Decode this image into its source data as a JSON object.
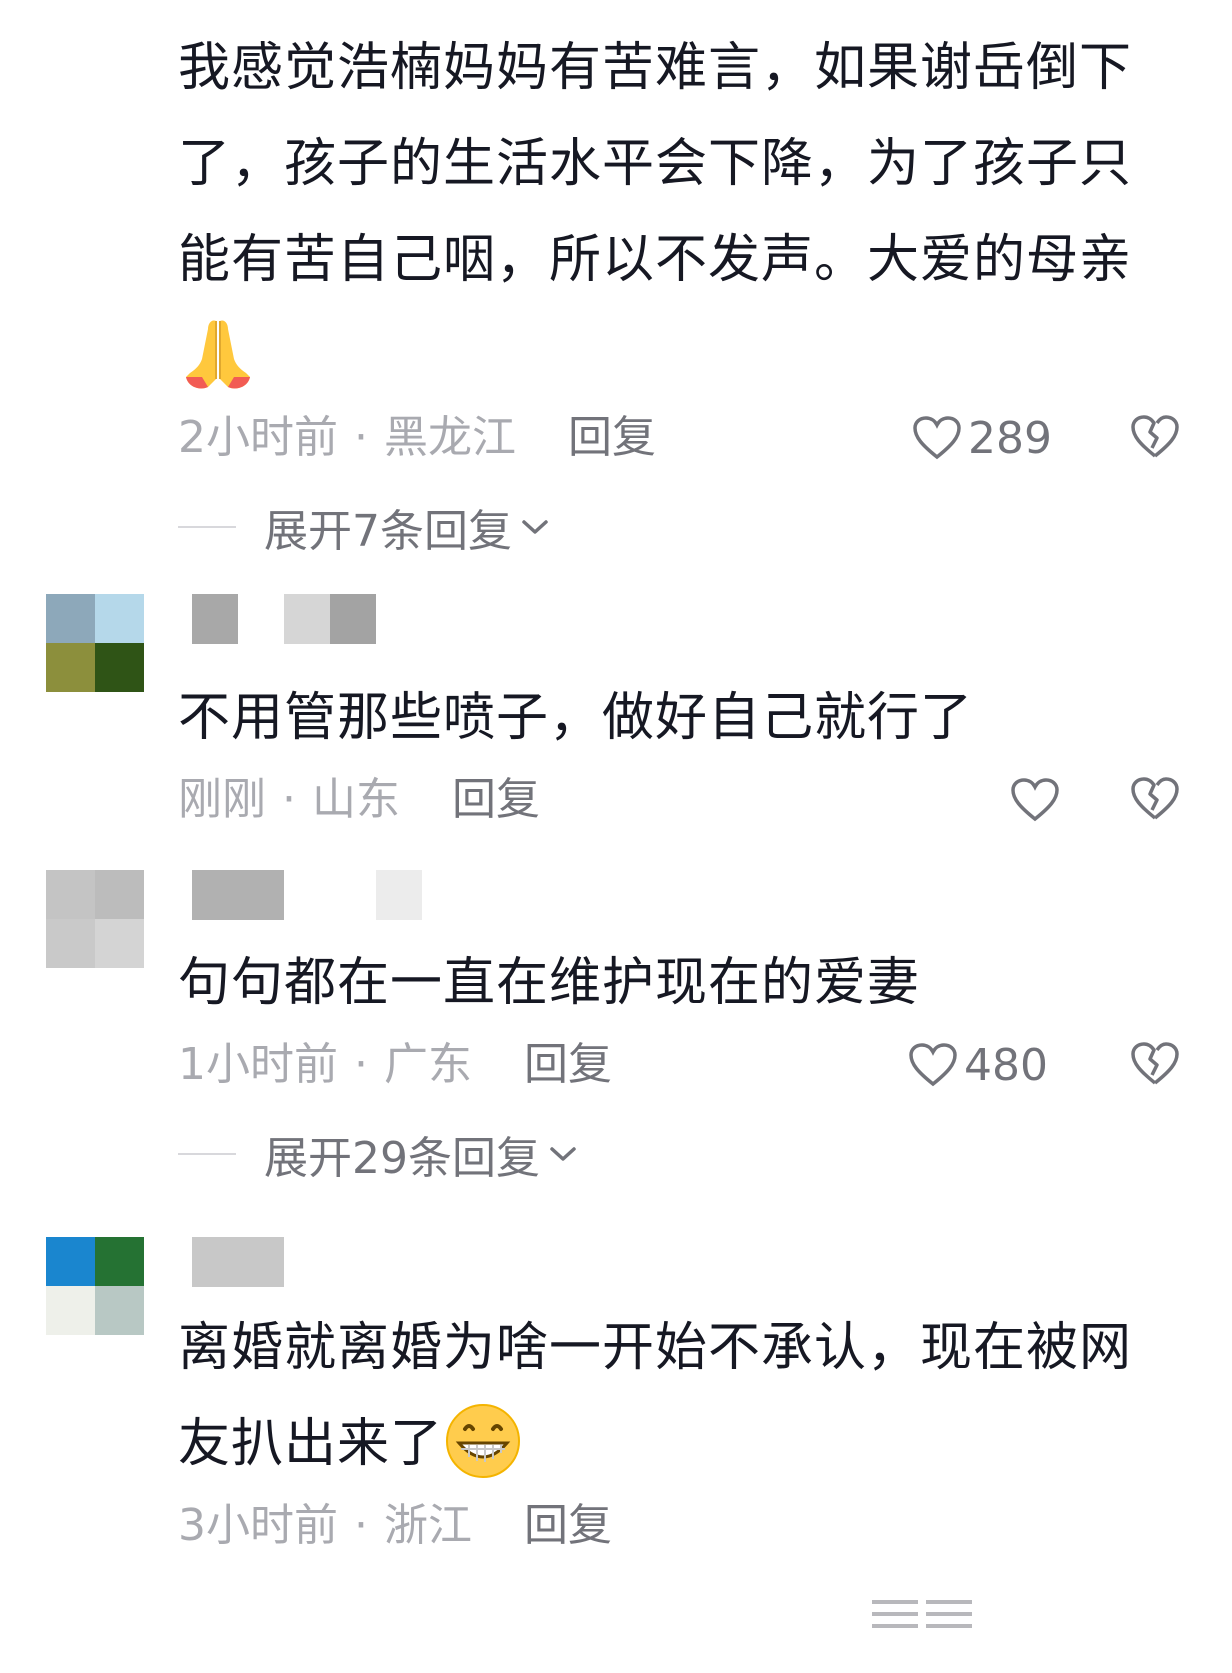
{
  "comments": [
    {
      "text": "我感觉浩楠妈妈有苦难言，如果谢岳倒下了，孩子的生活水平会下降，为了孩子只能有苦自己咽，所以不发声。大爱的母亲",
      "emoji": "folded-hands",
      "time": "2小时前",
      "location": "黑龙江",
      "reply_label": "回复",
      "likes": "289",
      "expand_label": "展开7条回复"
    },
    {
      "text": "不用管那些喷子，做好自己就行了",
      "time": "刚刚",
      "location": "山东",
      "reply_label": "回复",
      "likes": ""
    },
    {
      "text": "句句都在一直在维护现在的爱妻",
      "time": "1小时前",
      "location": "广东",
      "reply_label": "回复",
      "likes": "480",
      "expand_label": "展开29条回复"
    },
    {
      "text": "离婚就离婚为啥一开始不承认，现在被网友扒出来了",
      "emoji": "grinning-face",
      "time": "3小时前",
      "location": "浙江",
      "reply_label": "回复"
    }
  ],
  "separator": "·",
  "colors": {
    "text": "#161823",
    "meta": "#a9aab0",
    "action": "#72737a"
  }
}
